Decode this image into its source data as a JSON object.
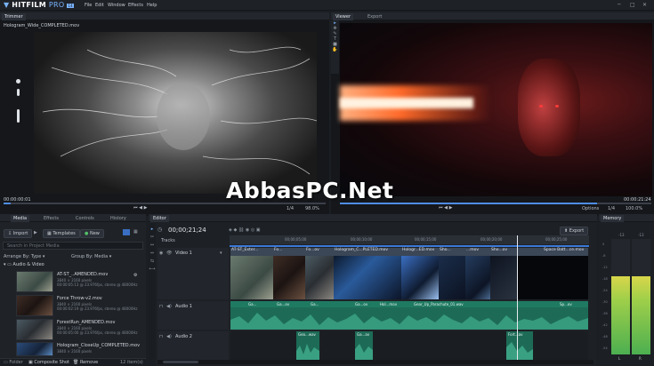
{
  "app": {
    "name_a": "HIT",
    "name_b": "FILM",
    "name_c": " PRO",
    "badge": "14"
  },
  "menu": [
    "File",
    "Edit",
    "Window",
    "Effects",
    "Help"
  ],
  "trimmer": {
    "tab": "Trimmer",
    "filename": "Hologram_Wide_COMPLETED.mov",
    "timecode": "00:00:00:01"
  },
  "viewer": {
    "tabs": [
      "Viewer",
      "Export"
    ],
    "timecode": "00:00:21:24",
    "zoom": "1/4",
    "fit": "98.0%",
    "options": "Options",
    "fit2": "100.0%"
  },
  "trimmer_controls": {
    "zoom": "1/4",
    "fit": "98.0%"
  },
  "media": {
    "tabs": [
      "Media",
      "Effects",
      "Controls",
      "History"
    ],
    "import": "Import",
    "templates": "Templates",
    "new": "New",
    "search_placeholder": "Search in Project Media",
    "arrange": "Arrange By: Type",
    "group": "Group By: Media",
    "folder": "Audio & Video",
    "assets": [
      {
        "name": "AT-ST_..AMENDED.mov",
        "meta1": "3840 × 2160 pixels",
        "meta2": "00:00:05:13 @ 23.976fps, stereo @ 48000Hz"
      },
      {
        "name": "Force Throw-v2.mov",
        "meta1": "3840 × 2160 pixels",
        "meta2": "00:00:02:19 @ 23.976fps, stereo @ 48000Hz"
      },
      {
        "name": "ForestRun_AMENDED.mov",
        "meta1": "3840 × 2160 pixels",
        "meta2": "00:00:05:00 @ 23.976fps, stereo @ 48000Hz"
      },
      {
        "name": "Hologram_CloseUp_COMPLETED.mov",
        "meta1": "3840 × 2160 pixels",
        "meta2": ""
      }
    ],
    "footer": {
      "folder": "Folder",
      "composite": "Composite Shot",
      "remove": "Remove",
      "count": "12 item(s)"
    }
  },
  "editor": {
    "tab": "Editor",
    "timecode": "00;00;21;24",
    "tracks_label": "Tracks",
    "export": "Export",
    "ruler": [
      "00;00;05;00",
      "00;00;10;00",
      "00;00;15;00",
      "00;00;20;00",
      "00;00;25;00"
    ],
    "video_track": "Video 1",
    "audio1": "Audio 1",
    "audio2": "Audio 2",
    "video_clips": [
      "AT-ST_Exter...",
      "Fo...",
      "Fo...ov",
      "Hologram_C...PLETED.mov",
      "Hologr...ED.mov",
      "Sho...",
      "...mov",
      "Sho...ov",
      "Gr...",
      "Sh...mov",
      "Space Batt...ce.mov"
    ],
    "audio_labels": [
      "Ga...",
      "Ga...ov",
      "Ga...",
      "Gear_...",
      "Ga...ov",
      "Hol...mov",
      "Gear_Up_Parachute_01.wav",
      "Gear",
      "Sp...ov"
    ],
    "audio2_labels": [
      "Gea...wav",
      "Ga...av",
      "Fort...av"
    ]
  },
  "memory": {
    "title": "Memory",
    "l": "L",
    "r": "R",
    "top_l": "-13",
    "top_r": "-13",
    "scale": [
      "0",
      "-6",
      "-12",
      "-18",
      "-24",
      "-30",
      "-36",
      "-42",
      "-48",
      "-54"
    ]
  },
  "watermark": "AbbasPC.Net"
}
